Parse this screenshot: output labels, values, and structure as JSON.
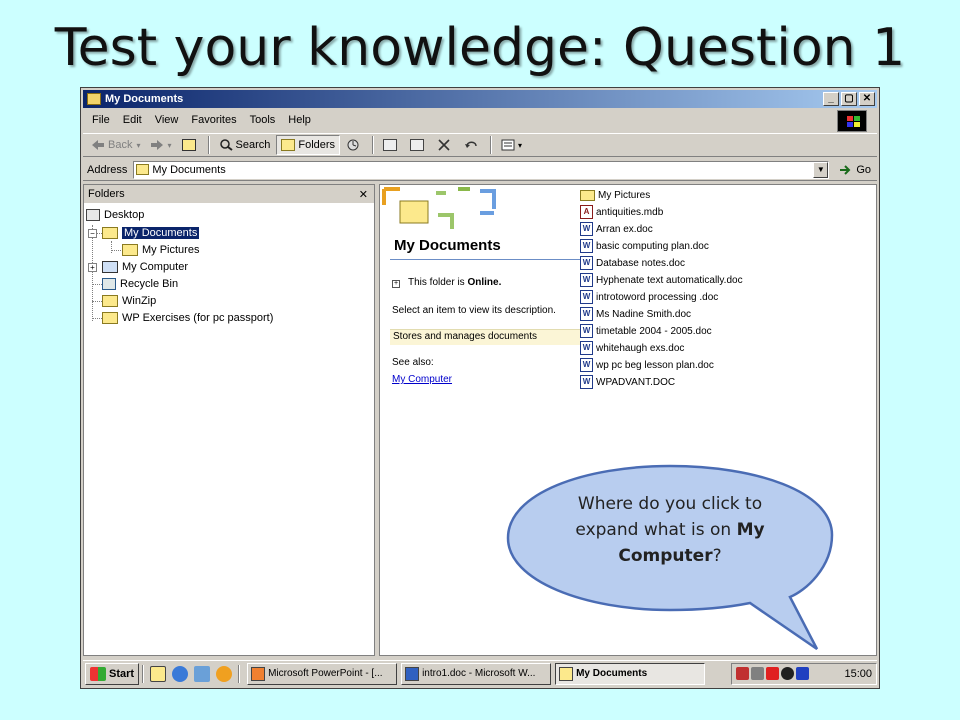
{
  "slide": {
    "title": "Test your knowledge: Question 1",
    "question_pre": "Where do you click to expand what is on ",
    "question_bold": "My Computer",
    "question_post": "?"
  },
  "window": {
    "title": "My Documents",
    "buttons": [
      "_",
      "▢",
      "✕"
    ]
  },
  "menu": [
    "File",
    "Edit",
    "View",
    "Favorites",
    "Tools",
    "Help"
  ],
  "toolbar": {
    "back": "Back",
    "search": "Search",
    "folders": "Folders"
  },
  "address": {
    "label": "Address",
    "value": "My Documents",
    "go": "Go"
  },
  "folders_pane": {
    "header": "Folders",
    "close": "✕",
    "items": [
      {
        "label": "Desktop"
      },
      {
        "label": "My Documents"
      },
      {
        "label": "My Pictures"
      },
      {
        "label": "My Computer"
      },
      {
        "label": "Recycle Bin"
      },
      {
        "label": "WinZip"
      },
      {
        "label": "WP Exercises (for pc passport)"
      }
    ]
  },
  "web_view": {
    "title": "My Documents",
    "online_pre": "This folder is ",
    "online_bold": "Online.",
    "select_text": "Select an item to view its description.",
    "description": "Stores and manages documents",
    "see_also": "See also:",
    "link": "My Computer"
  },
  "files": [
    {
      "name": "My Pictures",
      "type": "folder"
    },
    {
      "name": "antiquities.mdb",
      "type": "mdb"
    },
    {
      "name": "Arran ex.doc",
      "type": "doc"
    },
    {
      "name": "basic computing plan.doc",
      "type": "doc"
    },
    {
      "name": "Database notes.doc",
      "type": "doc"
    },
    {
      "name": "Hyphenate text automatically.doc",
      "type": "doc"
    },
    {
      "name": "introtoword processing .doc",
      "type": "doc"
    },
    {
      "name": "Ms Nadine Smith.doc",
      "type": "doc"
    },
    {
      "name": "timetable 2004 - 2005.doc",
      "type": "doc"
    },
    {
      "name": "whitehaugh exs.doc",
      "type": "doc"
    },
    {
      "name": "wp pc beg lesson plan.doc",
      "type": "doc"
    },
    {
      "name": "WPADVANT.DOC",
      "type": "doc"
    }
  ],
  "taskbar": {
    "start": "Start",
    "tasks": [
      {
        "label": "Microsoft PowerPoint - [..."
      },
      {
        "label": "intro1.doc - Microsoft W..."
      },
      {
        "label": "My Documents"
      }
    ],
    "clock": "15:00"
  },
  "colors": {
    "background": "#ccffff",
    "selection": "#0a246a",
    "callout": "#b8cdef"
  }
}
